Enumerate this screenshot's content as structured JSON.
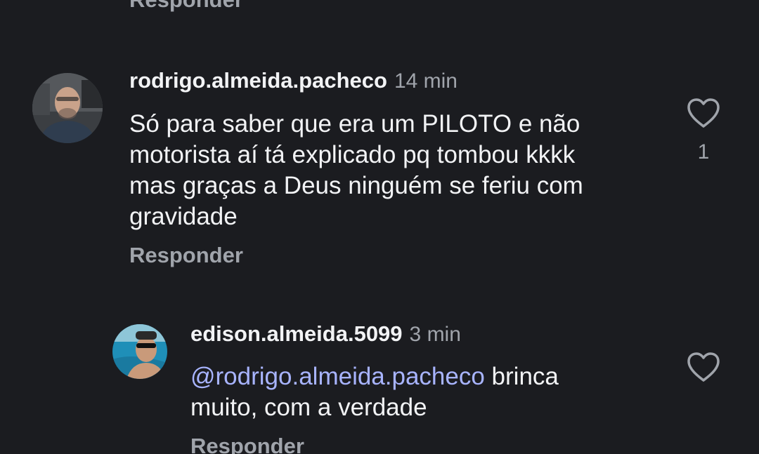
{
  "top_reply": {
    "label": "Responder"
  },
  "comments": [
    {
      "username": "rodrigo.almeida.pacheco",
      "time": "14 min",
      "text": "Só para saber que era um PILOTO e não\nmotorista aí tá explicado pq tombou kkkk\nmas graças a Deus ninguém se feriu com\ngravidade",
      "likes": "1",
      "reply_label": "Responder",
      "avatar_icon": "profile-photo"
    },
    {
      "username": "edison.almeida.5099",
      "time": "3 min",
      "mention": "@rodrigo.almeida.pacheco",
      "text": " brinca\nmuito,  com a verdade",
      "reply_label": "Responder",
      "avatar_icon": "profile-photo"
    }
  ],
  "icons": {
    "like": "heart-outline-icon",
    "mention": "threads-at-icon"
  },
  "colors": {
    "background": "#1b1c20",
    "text": "#f2f3f5",
    "muted": "#a0a4ab",
    "mention": "#a8b4ff"
  }
}
